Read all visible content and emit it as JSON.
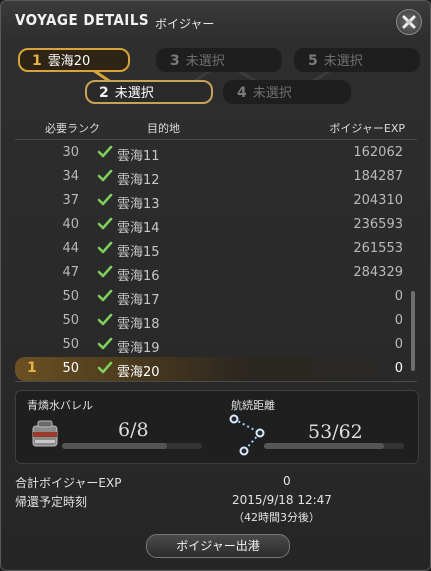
{
  "window": {
    "title": "VOYAGE DETAILS",
    "subtitle": "ボイジャー"
  },
  "routes": [
    {
      "num": "1",
      "label": "雲海20"
    },
    {
      "num": "2",
      "label": "未選択"
    },
    {
      "num": "3",
      "label": "未選択"
    },
    {
      "num": "4",
      "label": "未選択"
    },
    {
      "num": "5",
      "label": "未選択"
    }
  ],
  "table": {
    "headers": {
      "rank": "必要ランク",
      "dest": "目的地",
      "exp": "ボイジャーEXP"
    },
    "rows": [
      {
        "rank": "30",
        "dest": "雲海11",
        "exp": "162062"
      },
      {
        "rank": "34",
        "dest": "雲海12",
        "exp": "184287"
      },
      {
        "rank": "37",
        "dest": "雲海13",
        "exp": "204310"
      },
      {
        "rank": "40",
        "dest": "雲海14",
        "exp": "236593"
      },
      {
        "rank": "44",
        "dest": "雲海15",
        "exp": "261553"
      },
      {
        "rank": "47",
        "dest": "雲海16",
        "exp": "284329"
      },
      {
        "rank": "50",
        "dest": "雲海17",
        "exp": "0"
      },
      {
        "rank": "50",
        "dest": "雲海18",
        "exp": "0"
      },
      {
        "rank": "50",
        "dest": "雲海19",
        "exp": "0"
      },
      {
        "marker": "1",
        "rank": "50",
        "dest": "雲海20",
        "exp": "0"
      }
    ]
  },
  "status": {
    "fuel_label": "青燐水バレル",
    "fuel_value": "6/8",
    "fuel_fraction": 0.75,
    "distance_label": "航続距離",
    "distance_value": "53/62",
    "distance_fraction": 0.855
  },
  "summary": {
    "total_exp_label": "合計ボイジャーEXP",
    "total_exp_value": "0",
    "return_label": "帰還予定時刻",
    "return_time": "2015/9/18 12:47",
    "return_duration": "（42時間3分後）"
  },
  "depart_button": "ボイジャー出港",
  "icons": {
    "close": "close-icon",
    "check": "check-icon",
    "fuel": "fuel-barrel-icon",
    "route": "route-path-icon"
  },
  "colors": {
    "accent": "#e9b347",
    "check": "#7fcf5a"
  }
}
